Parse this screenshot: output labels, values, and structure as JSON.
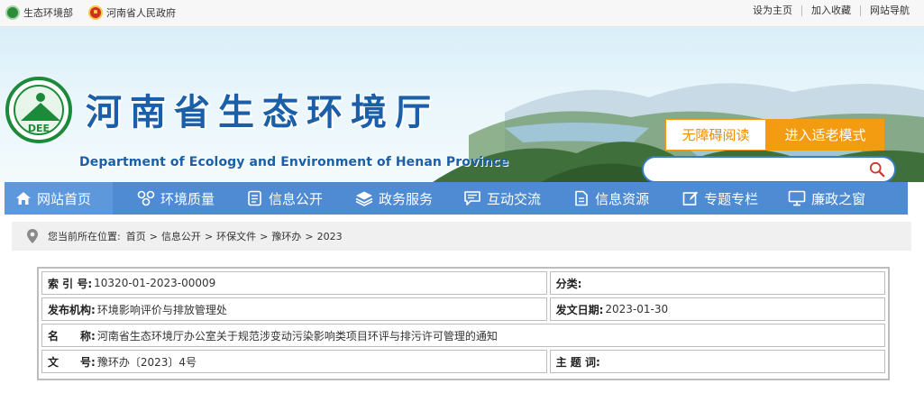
{
  "topbar": {
    "links_left": [
      {
        "label": "生态环境部",
        "icon": "ministry-emblem-icon"
      },
      {
        "label": "河南省人民政府",
        "icon": "national-emblem-icon"
      }
    ],
    "links_right": [
      "设为主页",
      "加入收藏",
      "网站导航"
    ]
  },
  "header": {
    "title_cn": "河南省生态环境厅",
    "title_en": "Department of Ecology and Environment of Henan Province",
    "logo_text": "DEE",
    "accessibility_label": "无障碍阅读",
    "elder_mode_label": "进入适老模式",
    "search": {
      "placeholder": "",
      "value": ""
    }
  },
  "nav": {
    "items": [
      {
        "label": "网站首页",
        "icon": "home-icon"
      },
      {
        "label": "环境质量",
        "icon": "environment-icon"
      },
      {
        "label": "信息公开",
        "icon": "document-icon"
      },
      {
        "label": "政务服务",
        "icon": "layers-icon"
      },
      {
        "label": "互动交流",
        "icon": "chat-icon"
      },
      {
        "label": "信息资源",
        "icon": "file-icon"
      },
      {
        "label": "专题专栏",
        "icon": "edit-icon"
      },
      {
        "label": "廉政之窗",
        "icon": "monitor-icon"
      }
    ]
  },
  "breadcrumb": {
    "prefix": "您当前所在位置:",
    "items": [
      "首页",
      "信息公开",
      "环保文件",
      "豫环办",
      "2023"
    ]
  },
  "info": {
    "index_label": "索 引 号:",
    "index_value": "10320-01-2023-00009",
    "category_label": "分类:",
    "category_value": "",
    "publisher_label": "发布机构:",
    "publisher_value": "环境影响评价与排放管理处",
    "date_label": "发文日期:",
    "date_value": "2023-01-30",
    "name_label": "名　　称:",
    "name_value": "河南省生态环境厅办公室关于规范涉变动污染影响类项目环评与排污许可管理的通知",
    "docno_label": "文　　号:",
    "docno_value": "豫环办〔2023〕4号",
    "subject_label": "主 题 词:",
    "subject_value": ""
  }
}
